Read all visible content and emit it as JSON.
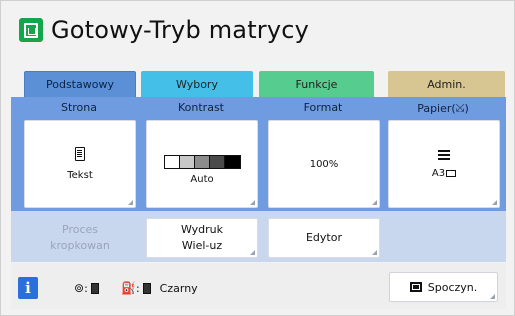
{
  "header": {
    "title": "Gotowy-Tryb matrycy",
    "title_icon": "master-making-icon",
    "title_icon_color": "#19a34a"
  },
  "tabs": [
    {
      "label": "Podstawowy",
      "color": "#5b8fd6",
      "selected": true
    },
    {
      "label": "Wybory",
      "color": "#44c0e8",
      "selected": false
    },
    {
      "label": "Funkcje",
      "color": "#57cc8f",
      "selected": false
    },
    {
      "label": "Admin.",
      "color": "#d7c691",
      "selected": false
    }
  ],
  "settings": {
    "strona": {
      "header": "Strona",
      "value": "Tekst",
      "icon": "document-icon"
    },
    "kontrast": {
      "header": "Kontrast",
      "value": "Auto",
      "icon": "contrast-scale-icon"
    },
    "format": {
      "header": "Format",
      "value": "100%"
    },
    "papier": {
      "header": "Papier(",
      "header_suffix": ")",
      "value": "A3",
      "icon": "paper-stack-icon"
    }
  },
  "actions": {
    "proces": {
      "line1": "Proces",
      "line2": "kropkowan",
      "enabled": false
    },
    "wydruk": {
      "line1": "Wydruk",
      "line2": "Wiel-uz",
      "enabled": true
    },
    "edytor": {
      "label": "Edytor",
      "enabled": true
    }
  },
  "status": {
    "info_glyph": "i",
    "ink_label": "Czarny",
    "rest_label": "Spoczyn."
  }
}
